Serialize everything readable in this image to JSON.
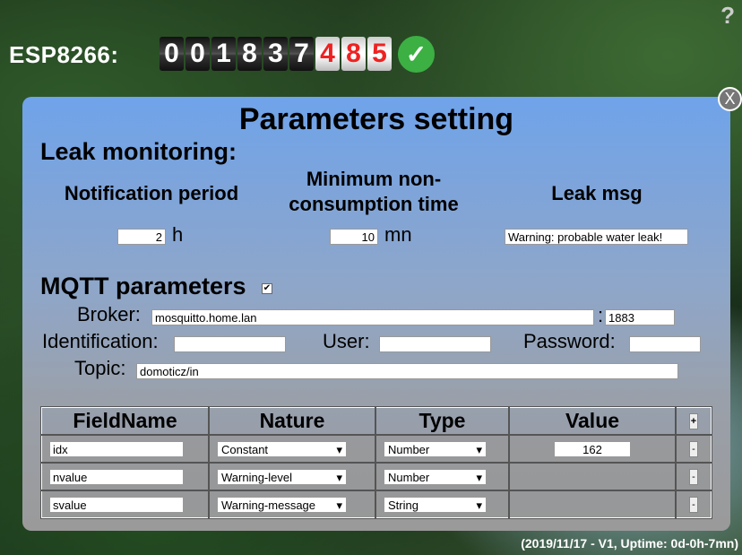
{
  "help": "?",
  "device": {
    "label": "ESP8266:",
    "digits": [
      "0",
      "0",
      "1",
      "8",
      "3",
      "7"
    ],
    "red_digits": [
      "4",
      "8",
      "5"
    ],
    "status_icon": "check-icon"
  },
  "panel": {
    "close": "X",
    "title": "Parameters setting",
    "leak": {
      "heading": "Leak monitoring:",
      "notif_label": "Notification period",
      "min_label": "Minimum non-consumption time",
      "msg_label": "Leak msg",
      "notif_value": "2",
      "notif_unit": "h",
      "min_value": "10",
      "min_unit": "mn",
      "msg_value": "Warning: probable water leak!"
    },
    "mqtt": {
      "heading": "MQTT parameters",
      "enabled_mark": "✔",
      "broker_label": "Broker:",
      "broker_value": "mosquitto.home.lan",
      "port_sep": ":",
      "port_value": "1883",
      "ident_label": "Identification:",
      "ident_value": "",
      "user_label": "User:",
      "user_value": "",
      "password_label": "Password:",
      "password_value": "",
      "topic_label": "Topic:",
      "topic_value": "domoticz/in"
    },
    "table": {
      "headers": [
        "FieldName",
        "Nature",
        "Type",
        "Value",
        "+"
      ],
      "rows": [
        {
          "field": "idx",
          "nature": "Constant",
          "type": "Number",
          "value": "162",
          "btn": "-"
        },
        {
          "field": "nvalue",
          "nature": "Warning-level",
          "type": "Number",
          "value": "",
          "btn": "-"
        },
        {
          "field": "svalue",
          "nature": "Warning-message",
          "type": "String",
          "value": "",
          "btn": "-"
        }
      ]
    }
  },
  "footer": "(2019/11/17 - V1, Uptime: 0d-0h-7mn)"
}
